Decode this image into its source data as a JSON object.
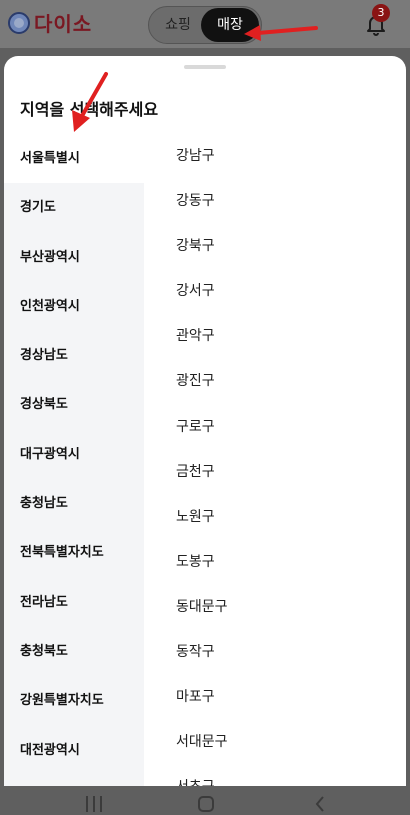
{
  "app_bar": {
    "logo_text": "다이소",
    "segments": [
      "쇼핑",
      "매장"
    ],
    "notification_count": "3"
  },
  "sheet": {
    "title": "지역을 선택해주세요",
    "regions": [
      "서울특별시",
      "경기도",
      "부산광역시",
      "인천광역시",
      "경상남도",
      "경상북도",
      "대구광역시",
      "충청남도",
      "전북특별자치도",
      "전라남도",
      "충청북도",
      "강원특별자치도",
      "대전광역시"
    ],
    "selected_region": "서울특별시",
    "districts": [
      "강남구",
      "강동구",
      "강북구",
      "강서구",
      "관악구",
      "광진구",
      "구로구",
      "금천구",
      "노원구",
      "도봉구",
      "동대문구",
      "동작구",
      "마포구",
      "서대문구",
      "서초구"
    ]
  },
  "colors": {
    "accent_red": "#e02020",
    "brand": "#7a1822"
  }
}
